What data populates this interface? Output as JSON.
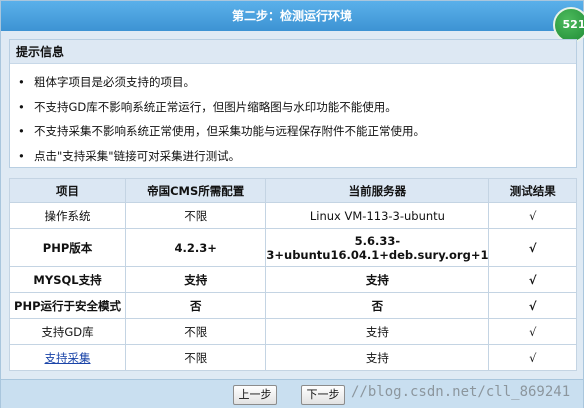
{
  "window": {
    "title": "第二步：检测运行环境",
    "badge": "521"
  },
  "tips": {
    "heading": "提示信息",
    "items": [
      "粗体字项目是必须支持的项目。",
      "不支持GD库不影响系统正常运行，但图片缩略图与水印功能不能使用。",
      "不支持采集不影响系统正常使用，但采集功能与远程保存附件不能正常使用。",
      "点击\"支持采集\"链接可对采集进行测试。"
    ]
  },
  "table": {
    "headers": [
      "项目",
      "帝国CMS所需配置",
      "当前服务器",
      "测试结果"
    ],
    "rows": [
      {
        "item": "操作系统",
        "required": "不限",
        "current": "Linux VM-113-3-ubuntu",
        "result": "√"
      },
      {
        "item": "PHP版本",
        "required": "4.2.3+",
        "current": "5.6.33-3+ubuntu16.04.1+deb.sury.org+1",
        "result": "√"
      },
      {
        "item": "MYSQL支持",
        "required": "支持",
        "current": "支持",
        "result": "√"
      },
      {
        "item": "PHP运行于安全模式",
        "required": "否",
        "current": "否",
        "result": "√"
      },
      {
        "item": "支持GD库",
        "required": "不限",
        "current": "支持",
        "result": "√"
      },
      {
        "item": "支持采集",
        "required": "不限",
        "current": "支持",
        "result": "√"
      }
    ]
  },
  "buttons": {
    "prev": "上一步",
    "next": "下一步"
  },
  "watermark": "//blog.csdn.net/cll_869241"
}
